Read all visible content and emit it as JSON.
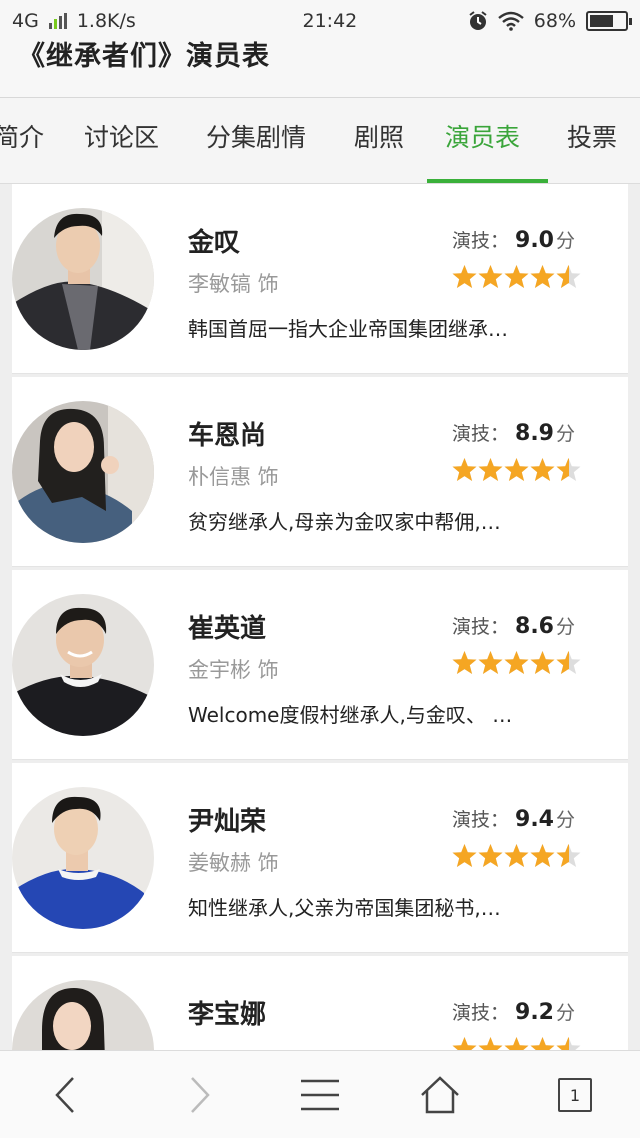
{
  "status_bar": {
    "network": "4G",
    "speed": "1.8K/s",
    "time": "21:42",
    "battery": "68%",
    "battery_level": 0.68,
    "alarm_icon": "alarm-clock-icon",
    "wifi_icon": "wifi-icon"
  },
  "page": {
    "title": "《继承者们》演员表"
  },
  "tabs": [
    {
      "label": "简介",
      "active": false
    },
    {
      "label": "讨论区",
      "active": false
    },
    {
      "label": "分集剧情",
      "active": false
    },
    {
      "label": "剧照",
      "active": false
    },
    {
      "label": "演员表",
      "active": true
    },
    {
      "label": "投票",
      "active": false
    }
  ],
  "labels": {
    "acting": "演技：",
    "unit": "分"
  },
  "cast": [
    {
      "name": "金叹",
      "actor": "李敏镐 饰",
      "score": "9.0",
      "rating": 4.5,
      "description": "韩国首屈一指大企业帝国集团继承…"
    },
    {
      "name": "车恩尚",
      "actor": "朴信惠 饰",
      "score": "8.9",
      "rating": 4.5,
      "description": "贫穷继承人,母亲为金叹家中帮佣,…"
    },
    {
      "name": "崔英道",
      "actor": "金宇彬 饰",
      "score": "8.6",
      "rating": 4.5,
      "description": "Welcome度假村继承人,与金叹、 …"
    },
    {
      "name": "尹灿荣",
      "actor": "姜敏赫 饰",
      "score": "9.4",
      "rating": 4.5,
      "description": "知性继承人,父亲为帝国集团秘书,…"
    },
    {
      "name": "李宝娜",
      "actor": "",
      "score": "9.2",
      "rating": 4.5,
      "description": ""
    }
  ],
  "colors": {
    "accent_green": "#3aa53a",
    "star_orange": "#f5a623",
    "star_empty": "#dddddd"
  },
  "bottom_nav": {
    "back_icon": "back-arrow-icon",
    "forward_icon": "forward-arrow-icon",
    "menu_icon": "menu-icon",
    "home_icon": "home-icon",
    "tabs_count": "1"
  }
}
